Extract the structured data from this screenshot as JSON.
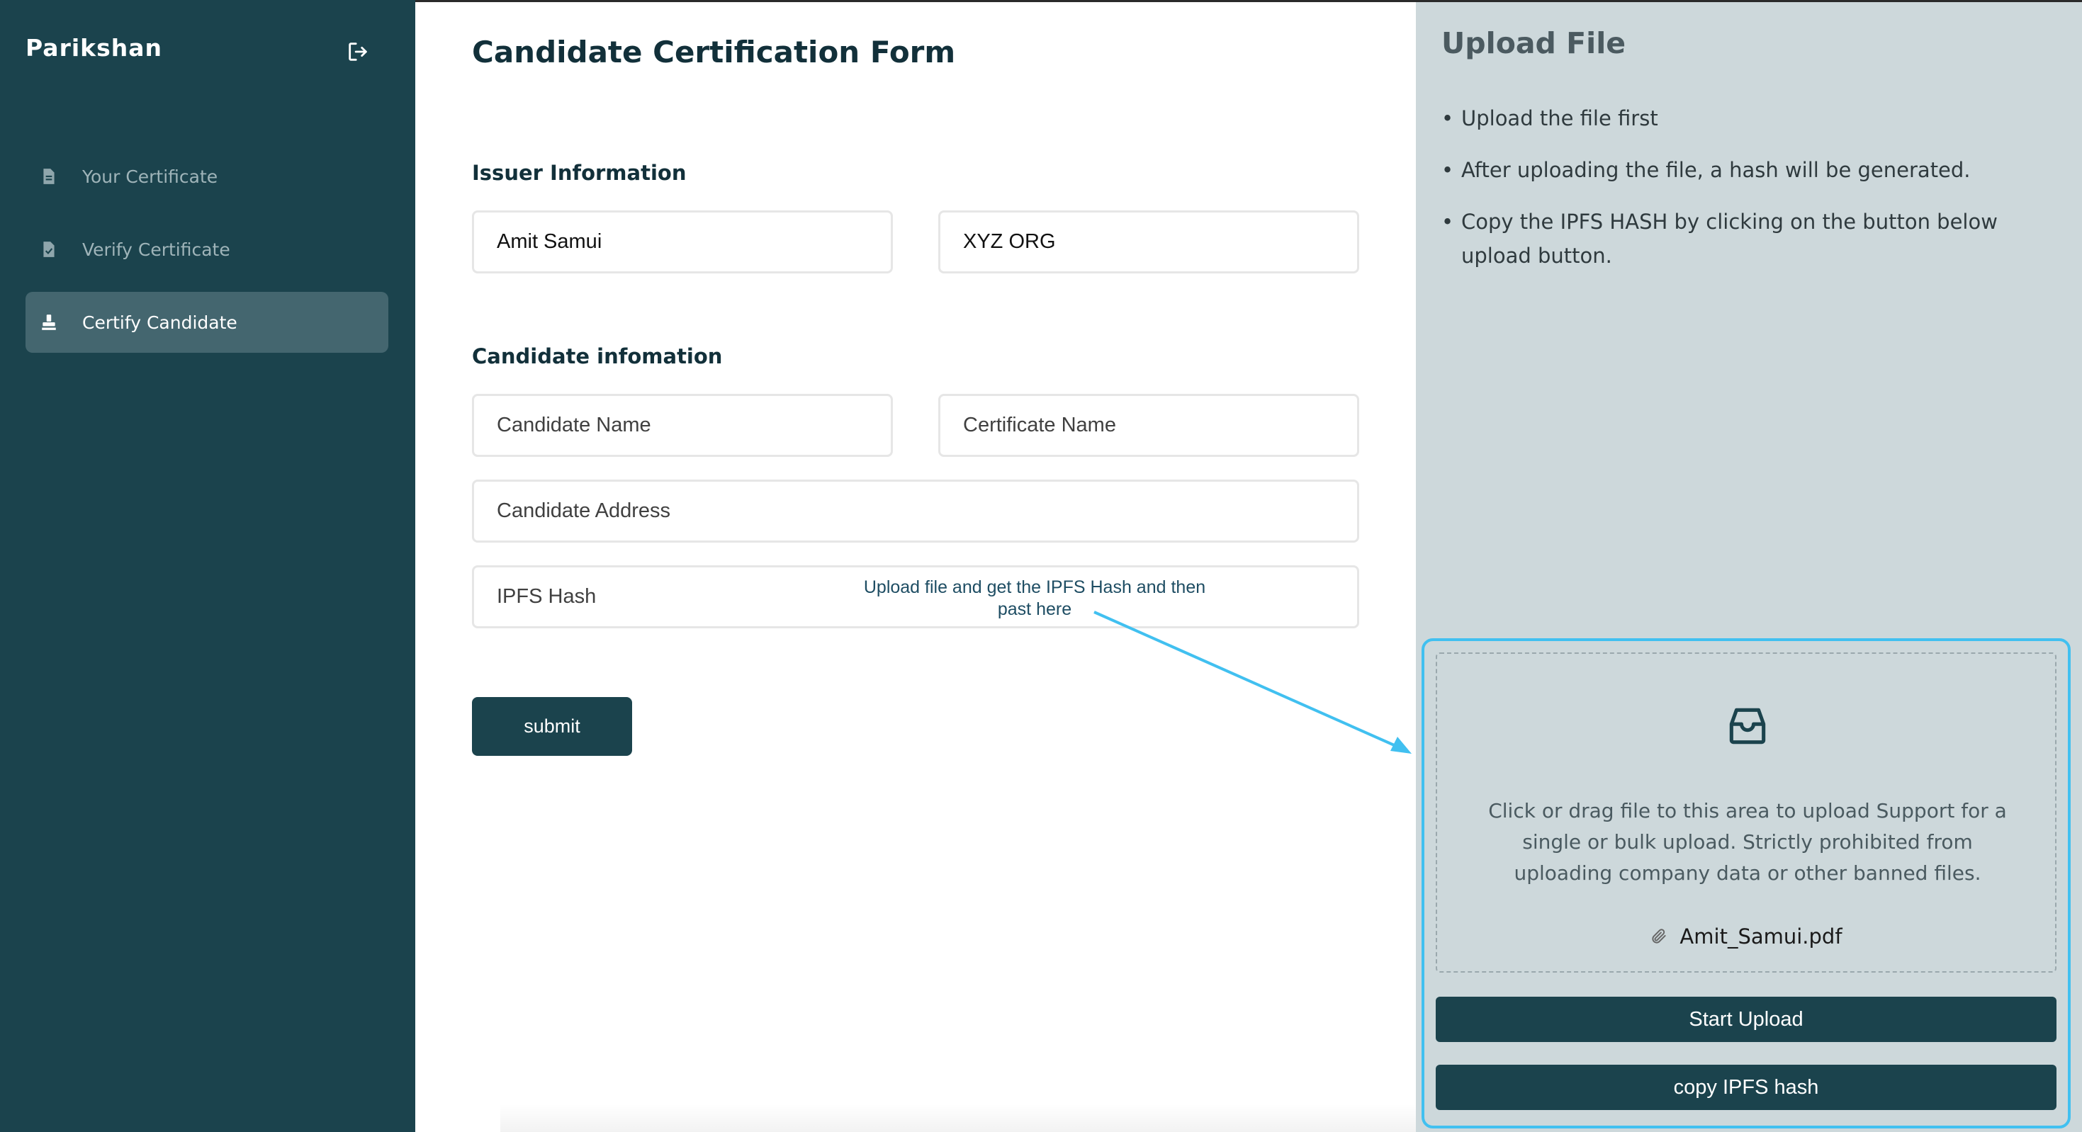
{
  "sidebar": {
    "brand": "Parikshan",
    "logout_icon": "logout-icon",
    "items": [
      {
        "label": "Your Certificate",
        "icon": "document-icon",
        "active": false
      },
      {
        "label": "Verify Certificate",
        "icon": "document-check-icon",
        "active": false
      },
      {
        "label": "Certify Candidate",
        "icon": "stamp-icon",
        "active": true
      }
    ]
  },
  "form": {
    "title": "Candidate Certification Form",
    "issuer_section": "Issuer Information",
    "issuer_name_value": "Amit Samui",
    "issuer_org_value": "XYZ ORG",
    "candidate_section": "Candidate infomation",
    "candidate_name_placeholder": "Candidate Name",
    "certificate_name_placeholder": "Certificate Name",
    "candidate_address_placeholder": "Candidate Address",
    "ipfs_hash_placeholder": "IPFS Hash",
    "hint": "Upload file and get the IPFS Hash and then past here",
    "submit_label": "submit"
  },
  "upload": {
    "title": "Upload File",
    "steps": [
      "Upload the file first",
      "After uploading the file, a hash will be generated.",
      "Copy the IPFS HASH by clicking on the button below upload button."
    ],
    "dropzone_text": "Click or drag file to this area to upload Support for a single or bulk upload. Strictly prohibited from uploading company data or other banned files.",
    "file_name": "Amit_Samui.pdf",
    "start_upload_label": "Start Upload",
    "copy_hash_label": "copy IPFS hash"
  },
  "colors": {
    "sidebar_bg": "#1b434d",
    "active_item_bg": "#44666f",
    "panel_bg": "#cdd8db",
    "accent_blue": "#41c0f0",
    "button_dark": "#1b434d"
  }
}
